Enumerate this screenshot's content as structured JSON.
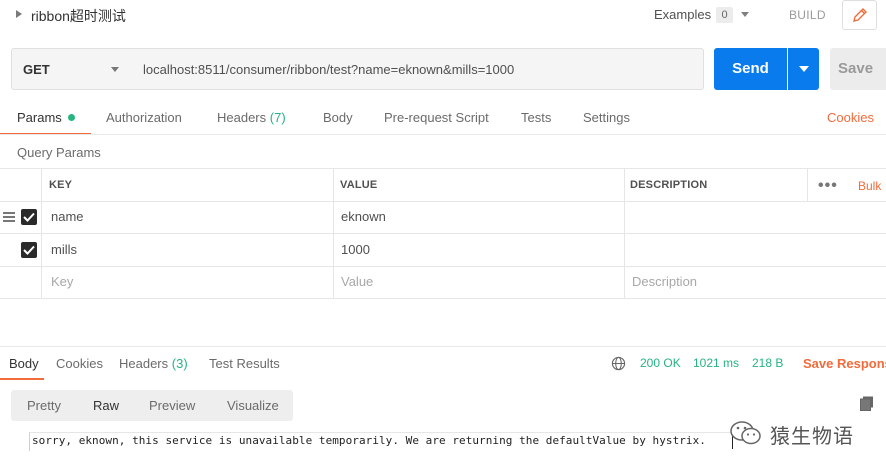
{
  "titlebar": {
    "title": "ribbon超时测试",
    "examples_label": "Examples",
    "examples_count": "0",
    "build_label": "BUILD"
  },
  "request": {
    "method": "GET",
    "url": "localhost:8511/consumer/ribbon/test?name=eknown&mills=1000",
    "send_label": "Send",
    "save_label": "Save"
  },
  "request_tabs": [
    {
      "label": "Params",
      "active": true
    },
    {
      "label": "Authorization"
    },
    {
      "label": "Headers",
      "count": "(7)"
    },
    {
      "label": "Body"
    },
    {
      "label": "Pre-request Script"
    },
    {
      "label": "Tests"
    },
    {
      "label": "Settings"
    }
  ],
  "cookies_link": "Cookies",
  "query_params": {
    "title": "Query Params",
    "columns": [
      "KEY",
      "VALUE",
      "DESCRIPTION"
    ],
    "bulk_label": "Bulk",
    "rows": [
      {
        "key": "name",
        "value": "eknown",
        "description": "",
        "checked": true
      },
      {
        "key": "mills",
        "value": "1000",
        "description": "",
        "checked": true
      }
    ],
    "placeholder": {
      "key": "Key",
      "value": "Value",
      "description": "Description"
    }
  },
  "response": {
    "tabs": [
      {
        "label": "Body",
        "active": true
      },
      {
        "label": "Cookies"
      },
      {
        "label": "Headers",
        "count": "(3)"
      },
      {
        "label": "Test Results"
      }
    ],
    "status": "200 OK",
    "time": "1021 ms",
    "size": "218 B",
    "save_label": "Save Respons",
    "view_tabs": [
      "Pretty",
      "Raw",
      "Preview",
      "Visualize"
    ],
    "active_view": "Raw",
    "body": "sorry, eknown, this service is unavailable temporarily. We are returning the defaultValue by hystrix."
  },
  "watermark": "猿生物语",
  "colors": {
    "accent": "#f26b3a",
    "send": "#097bed",
    "success": "#26b47f"
  }
}
